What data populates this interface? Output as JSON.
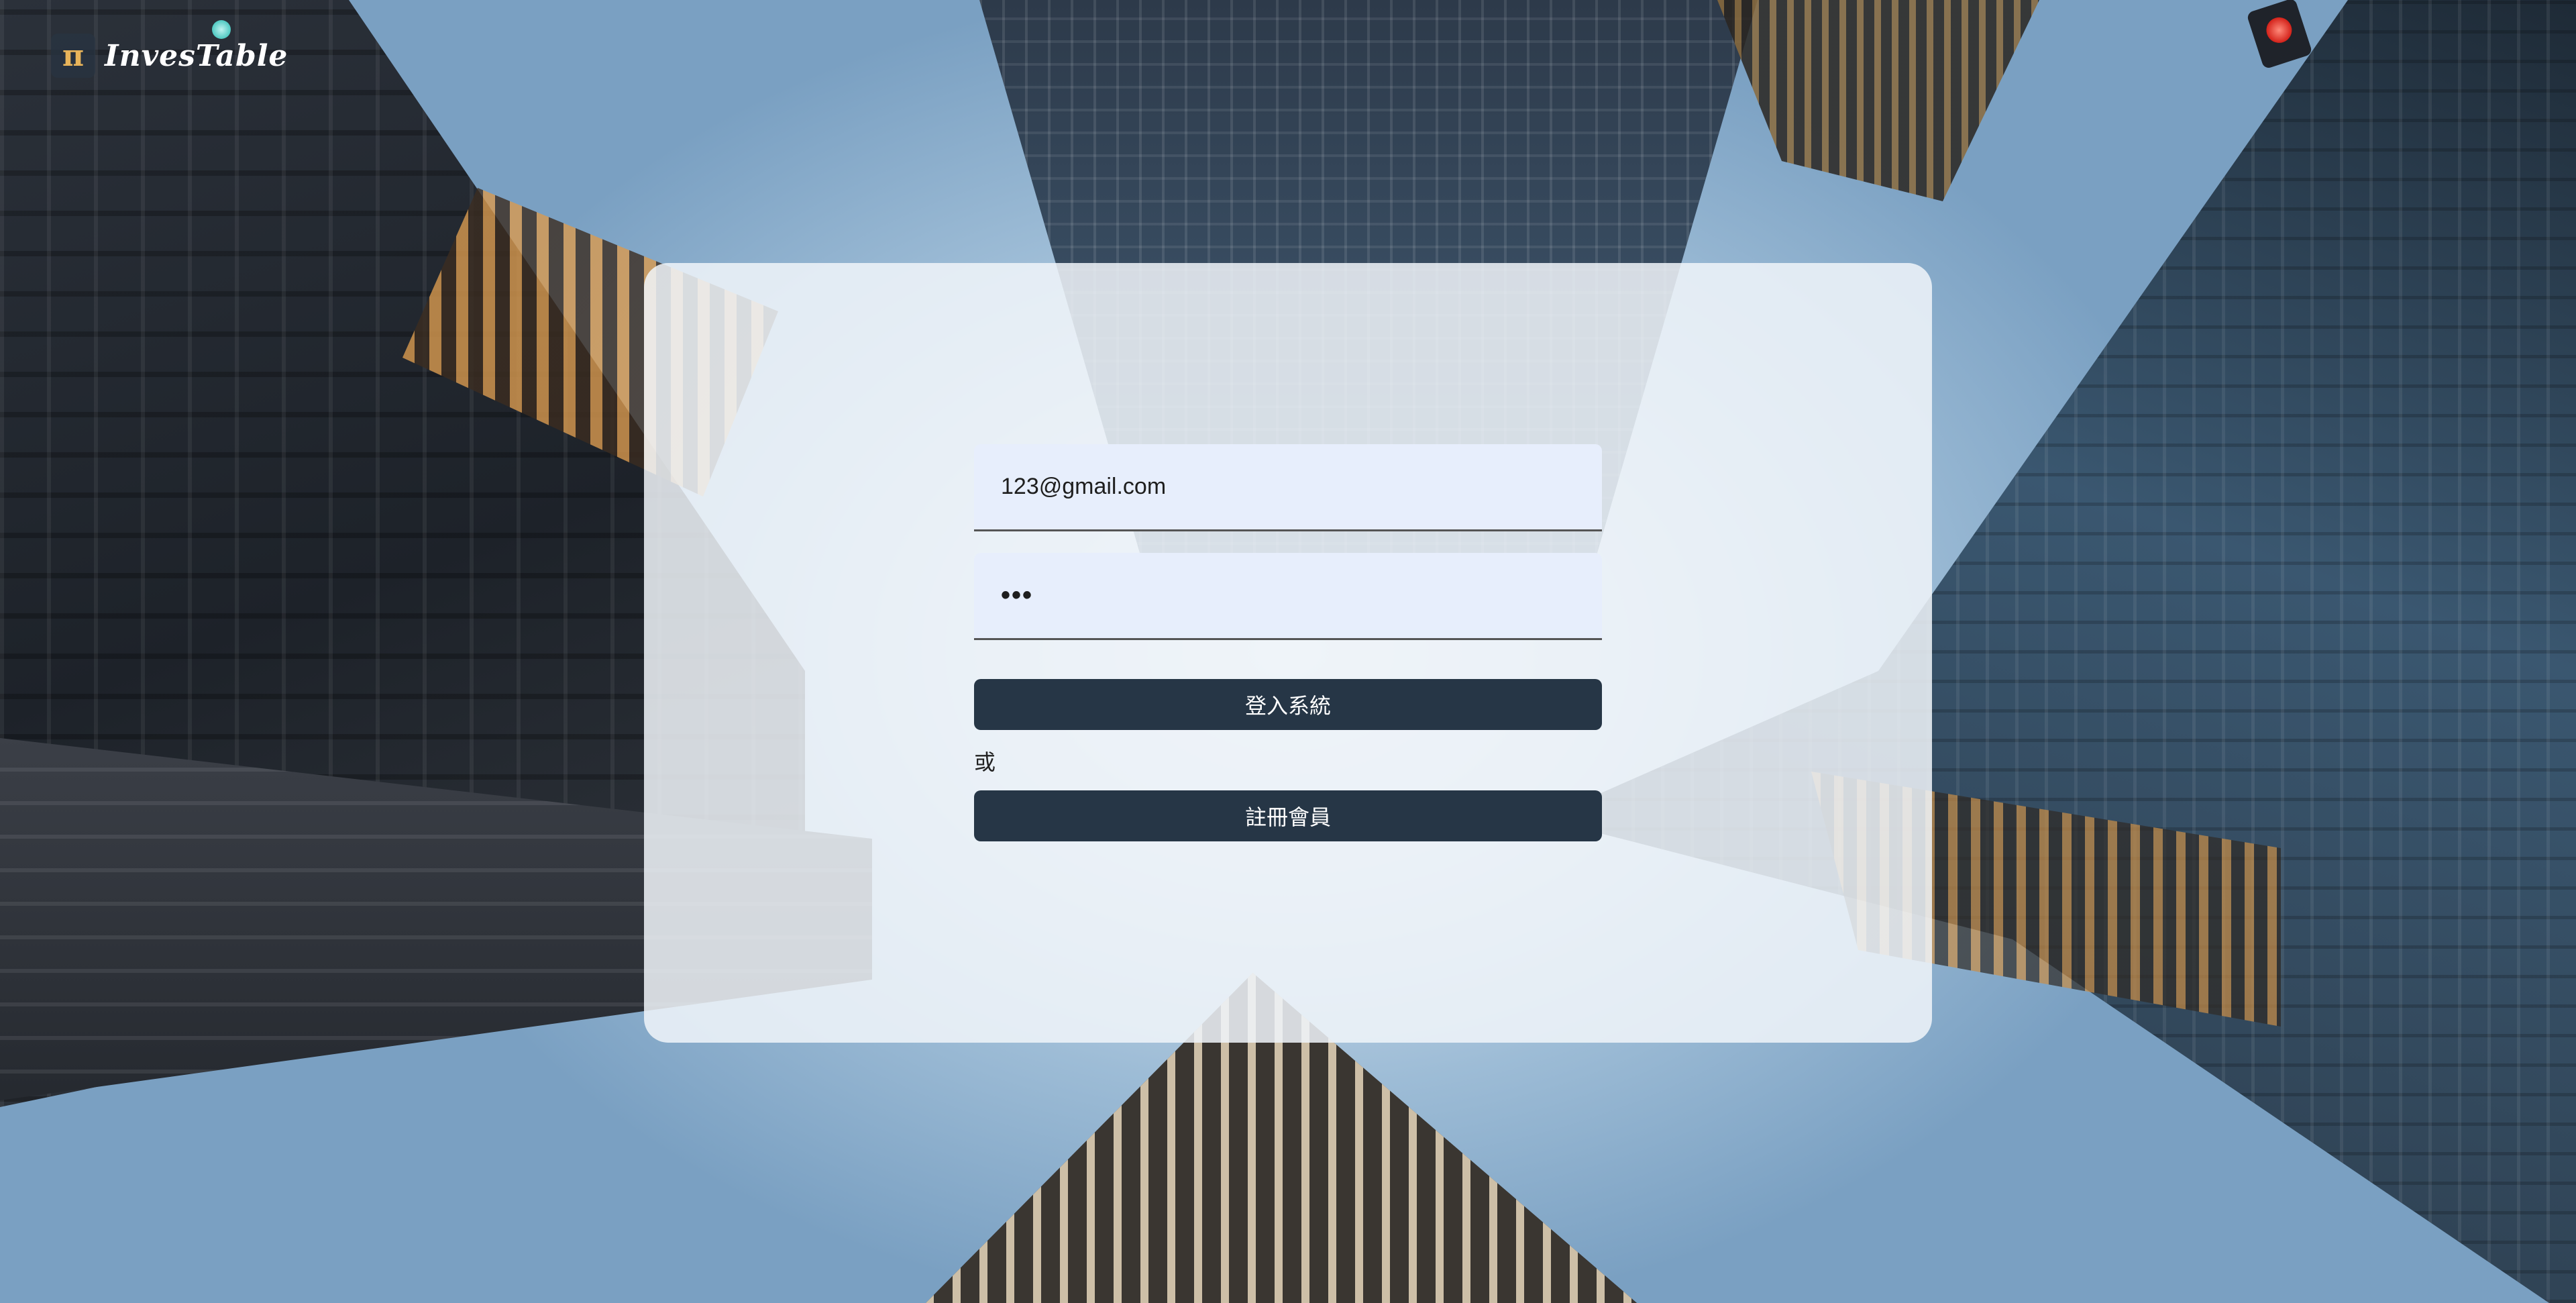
{
  "brand": {
    "name": "InvesTable",
    "logo_glyph": "π"
  },
  "login": {
    "email_value": "123@gmail.com",
    "password_value": "•••",
    "login_button": "登入系統",
    "or_label": "或",
    "register_button": "註冊會員"
  },
  "colors": {
    "button_bg": "#263646",
    "input_bg": "#e7eefc",
    "card_bg": "#f0f4f9",
    "logo_accent": "#e8b45a"
  }
}
